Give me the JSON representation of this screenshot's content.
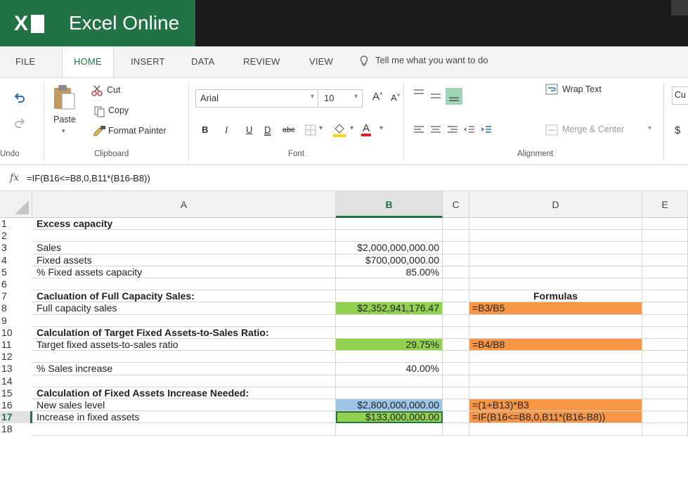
{
  "app": {
    "name": "Excel Online"
  },
  "ribbon": {
    "tabs": [
      "FILE",
      "HOME",
      "INSERT",
      "DATA",
      "REVIEW",
      "VIEW"
    ],
    "active_tab": "HOME",
    "tell_me": "Tell me what you want to do",
    "undo_group_label": "Undo",
    "clipboard": {
      "label": "Clipboard",
      "paste": "Paste",
      "cut": "Cut",
      "copy": "Copy",
      "format_painter": "Format Painter"
    },
    "font": {
      "label": "Font",
      "name": "Arial",
      "size": "10",
      "grow": "Aˆ",
      "shrink": "Aˇ",
      "bold": "B",
      "italic": "I",
      "underline": "U",
      "double_underline": "D",
      "strike": "abc",
      "font_color": "A"
    },
    "alignment": {
      "label": "Alignment",
      "wrap_text": "Wrap Text",
      "merge_center": "Merge & Center"
    },
    "number": {
      "format_partial": "Cu",
      "currency_symbol": "$"
    }
  },
  "formula_bar": {
    "fx": "fx",
    "formula": "=IF(B16<=B8,0,B11*(B16-B8))"
  },
  "sheet": {
    "columns": [
      "A",
      "B",
      "C",
      "D",
      "E"
    ],
    "selected_column": "B",
    "selected_row": "17",
    "rows": [
      {
        "n": "1",
        "a": "Excess capacity",
        "a_bold": true,
        "b": "",
        "d": ""
      },
      {
        "n": "2",
        "a": "",
        "b": "",
        "d": ""
      },
      {
        "n": "3",
        "a": "Sales",
        "b": "$2,000,000,000.00",
        "d": ""
      },
      {
        "n": "4",
        "a": "Fixed assets",
        "b": "$700,000,000.00",
        "d": ""
      },
      {
        "n": "5",
        "a": "% Fixed assets capacity",
        "b": "85.00%",
        "d": ""
      },
      {
        "n": "6",
        "a": "",
        "b": "",
        "d": ""
      },
      {
        "n": "7",
        "a": "Cacluation of Full Capacity Sales:",
        "a_bold": true,
        "b": "",
        "d": "Formulas",
        "d_bold": true,
        "d_center": true
      },
      {
        "n": "8",
        "a": "Full capacity sales",
        "b": "$2,352,941,176.47",
        "b_fill": "#92d050",
        "d": "=B3/B5",
        "d_fill": "#f79646"
      },
      {
        "n": "9",
        "a": "",
        "b": "",
        "d": ""
      },
      {
        "n": "10",
        "a": "Calculation of Target Fixed Assets-to-Sales Ratio:",
        "a_bold": true,
        "b": "",
        "d": ""
      },
      {
        "n": "11",
        "a": "Target fixed assets-to-sales ratio",
        "b": "29.75%",
        "b_fill": "#92d050",
        "d": "=B4/B8",
        "d_fill": "#f79646"
      },
      {
        "n": "12",
        "a": "",
        "b": "",
        "d": ""
      },
      {
        "n": "13",
        "a": "% Sales increase",
        "b": "40.00%",
        "d": ""
      },
      {
        "n": "14",
        "a": "",
        "b": "",
        "d": ""
      },
      {
        "n": "15",
        "a": "Calculation of Fixed Assets Increase Needed:",
        "a_bold": true,
        "b": "",
        "d": ""
      },
      {
        "n": "16",
        "a": "New sales level",
        "b": "$2,800,000,000.00",
        "b_fill": "#9dc3e6",
        "d": "=(1+B13)*B3",
        "d_fill": "#f79646"
      },
      {
        "n": "17",
        "a": "Increase in fixed assets",
        "b": "$133,000,000.00",
        "b_fill": "#92d050",
        "b_active": true,
        "d": "=IF(B16<=B8,0,B11*(B16-B8))",
        "d_fill": "#f79646"
      },
      {
        "n": "18",
        "a": "",
        "b": "",
        "d": ""
      }
    ]
  },
  "colors": {
    "brand": "#217346",
    "green_fill": "#92d050",
    "orange_fill": "#f79646",
    "blue_fill": "#9dc3e6"
  }
}
